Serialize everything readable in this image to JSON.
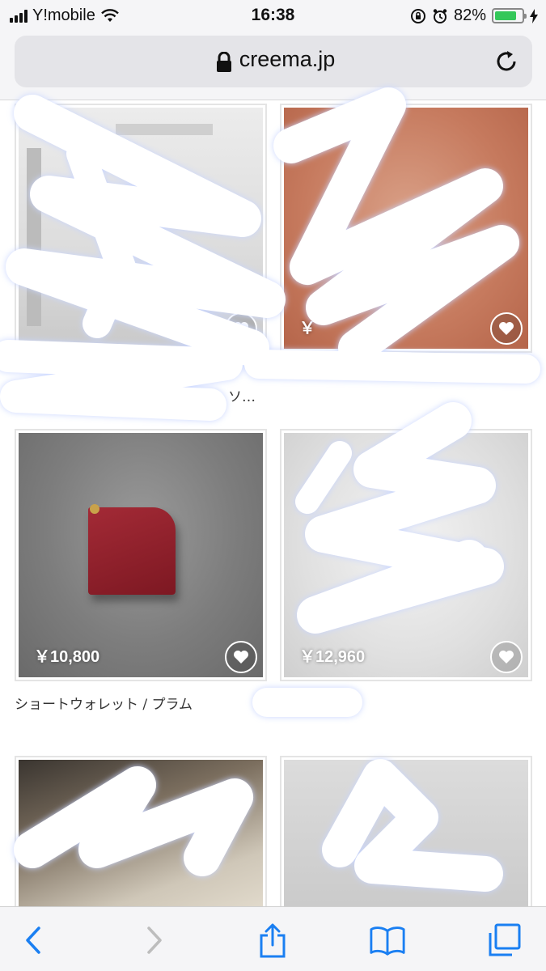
{
  "status_bar": {
    "carrier": "Y!mobile",
    "time": "16:38",
    "battery_percent": "82%",
    "battery_level": 0.82,
    "battery_color": "#34c759"
  },
  "url_bar": {
    "url": "creema.jp"
  },
  "products": [
    {
      "price": "",
      "title": ""
    },
    {
      "price": "￥",
      "title": ""
    },
    {
      "price": "",
      "title": "ソ…"
    },
    {
      "price": "￥10,800",
      "title": "ショートウォレット / プラム"
    },
    {
      "price": "￥12,960",
      "title": ""
    },
    {
      "price": "",
      "title": ""
    },
    {
      "price": "",
      "title": ""
    }
  ],
  "toolbar": {
    "icons": [
      "back-icon",
      "forward-icon",
      "share-icon",
      "bookmarks-icon",
      "tabs-icon"
    ]
  },
  "colors": {
    "accent": "#1a7ff2",
    "wallet": "#8a1c26"
  }
}
